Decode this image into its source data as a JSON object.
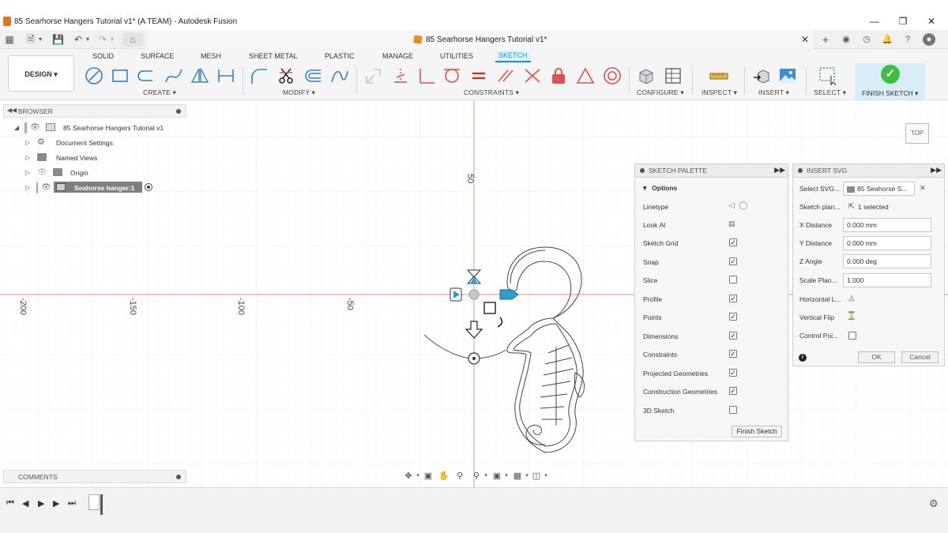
{
  "window": {
    "title": "85 Searhorse Hangers Tutorial v1* (A TEAM) - Autodesk Fusion",
    "document_tab": "85 Searhorse Hangers Tutorial v1*"
  },
  "ribbon": {
    "workspace_button": "DESIGN ▾",
    "tabs": [
      "SOLID",
      "SURFACE",
      "MESH",
      "SHEET METAL",
      "PLASTIC",
      "MANAGE",
      "UTILITIES",
      "SKETCH"
    ],
    "active_tab": "SKETCH",
    "groups": {
      "create": "CREATE ▾",
      "modify": "MODIFY ▾",
      "constraints": "CONSTRAINTS ▾",
      "configure": "CONFIGURE ▾",
      "inspect": "INSPECT ▾",
      "insert": "INSERT ▾",
      "select": "SELECT ▾",
      "finish_sketch": "FINISH SKETCH ▾"
    },
    "accent_color": "#0696d7"
  },
  "browser": {
    "header": "BROWSER",
    "root": "85 Searhorse Hangers Tutorial v1",
    "items": [
      "Document Settings",
      "Named Views",
      "Origin",
      "Seahorse hanger:1"
    ]
  },
  "comments": {
    "header": "COMMENTS"
  },
  "canvas": {
    "axis_labels": [
      "-200",
      "-150",
      "-100",
      "-50",
      "50"
    ],
    "viewcube_label": "TOP"
  },
  "sketch_palette": {
    "header": "SKETCH PALETTE",
    "section": "Options",
    "rows": [
      {
        "label": "Linetype",
        "kind": "icons"
      },
      {
        "label": "Look At",
        "kind": "icon"
      },
      {
        "label": "Sketch Grid",
        "kind": "check",
        "checked": true
      },
      {
        "label": "Snap",
        "kind": "check",
        "checked": true
      },
      {
        "label": "Slice",
        "kind": "check",
        "checked": false
      },
      {
        "label": "Profile",
        "kind": "check",
        "checked": true
      },
      {
        "label": "Points",
        "kind": "check",
        "checked": true
      },
      {
        "label": "Dimensions",
        "kind": "check",
        "checked": true
      },
      {
        "label": "Constraints",
        "kind": "check",
        "checked": true
      },
      {
        "label": "Projected Geometries",
        "kind": "check",
        "checked": true
      },
      {
        "label": "Construction Geometries",
        "kind": "check",
        "checked": true
      },
      {
        "label": "3D Sketch",
        "kind": "check",
        "checked": false
      }
    ],
    "finish_button": "Finish Sketch"
  },
  "insert_svg": {
    "header": "INSERT SVG",
    "select_svg_label": "Select SVG...",
    "select_svg_value": "85 Seahorse S...",
    "sketch_plane_label": "Sketch plan...",
    "sketch_plane_value": "1 selected",
    "x_distance_label": "X Distance",
    "x_distance_value": "0.000 mm",
    "y_distance_label": "Y Distance",
    "y_distance_value": "0.000 mm",
    "z_angle_label": "Z Angle",
    "z_angle_value": "0.000 deg",
    "scale_label": "Scale Plan...",
    "scale_value": "1.000",
    "horizontal_flip_label": "Horizontal L...",
    "vertical_flip_label": "Vertical Flip",
    "control_points_label": "Control Poi...",
    "ok_label": "OK",
    "cancel_label": "Cancel"
  }
}
